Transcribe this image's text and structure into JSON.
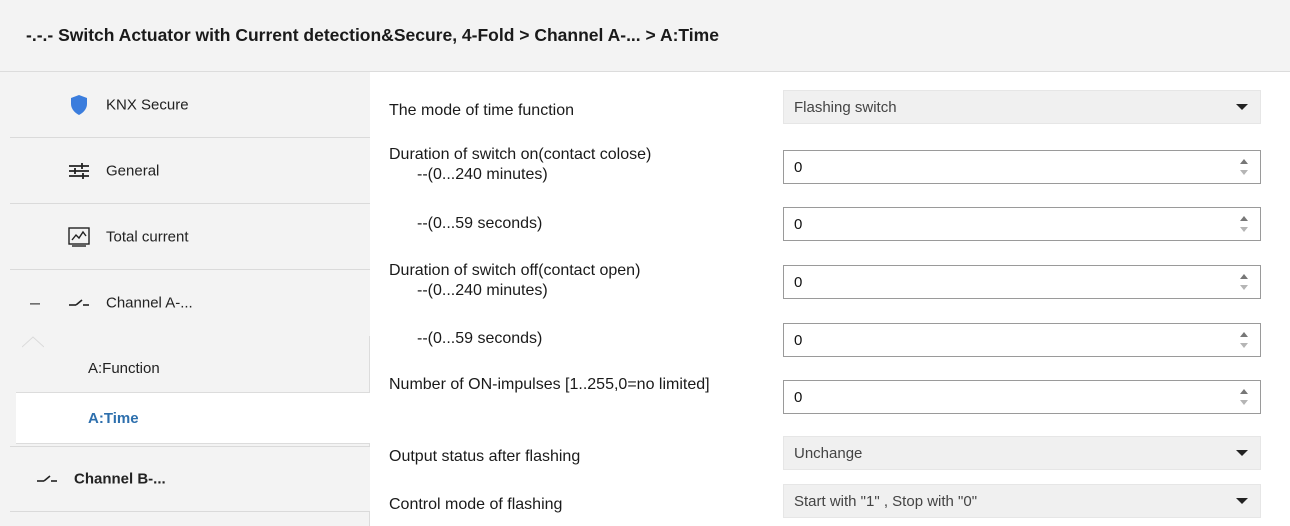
{
  "header": {
    "title": "-.-.- Switch Actuator with Current detection&Secure, 4-Fold > Channel A-... >   A:Time"
  },
  "sidebar": {
    "items": [
      {
        "label": "KNX Secure",
        "icon": "shield-icon"
      },
      {
        "label": "General",
        "icon": "sliders-icon"
      },
      {
        "label": "Total current",
        "icon": "chart-icon"
      },
      {
        "label": "Channel A-...",
        "icon": "switch-contact-icon",
        "expanded": true,
        "toggle": "–"
      },
      {
        "label": "Channel B-...",
        "icon": "switch-contact-icon"
      }
    ],
    "sub_items": [
      {
        "label": "A:Function"
      },
      {
        "label": "A:Time",
        "active": true
      }
    ]
  },
  "params": {
    "mode": {
      "label": "The mode of time function",
      "value": "Flashing switch"
    },
    "on_minutes": {
      "label": "Duration of switch on(contact colose)",
      "sublabel": "--(0...240 minutes)",
      "value": "0"
    },
    "on_seconds": {
      "label": "--(0...59 seconds)",
      "value": "0"
    },
    "off_minutes": {
      "label": "Duration of switch off(contact open)",
      "sublabel": "--(0...240 minutes)",
      "value": "0"
    },
    "off_seconds": {
      "label": "--(0...59 seconds)",
      "value": "0"
    },
    "impulses": {
      "label": "Number of ON-impulses [1..255,0=no limited]",
      "value": "0"
    },
    "output_status": {
      "label": "Output status after flashing",
      "value": "Unchange"
    },
    "control_mode": {
      "label": "Control mode of flashing",
      "value": "Start with \"1\" , Stop with \"0\""
    }
  },
  "colors": {
    "accent": "#2d6fad",
    "shield": "#3b7ddd",
    "panel_bg": "#f3f3f3"
  }
}
